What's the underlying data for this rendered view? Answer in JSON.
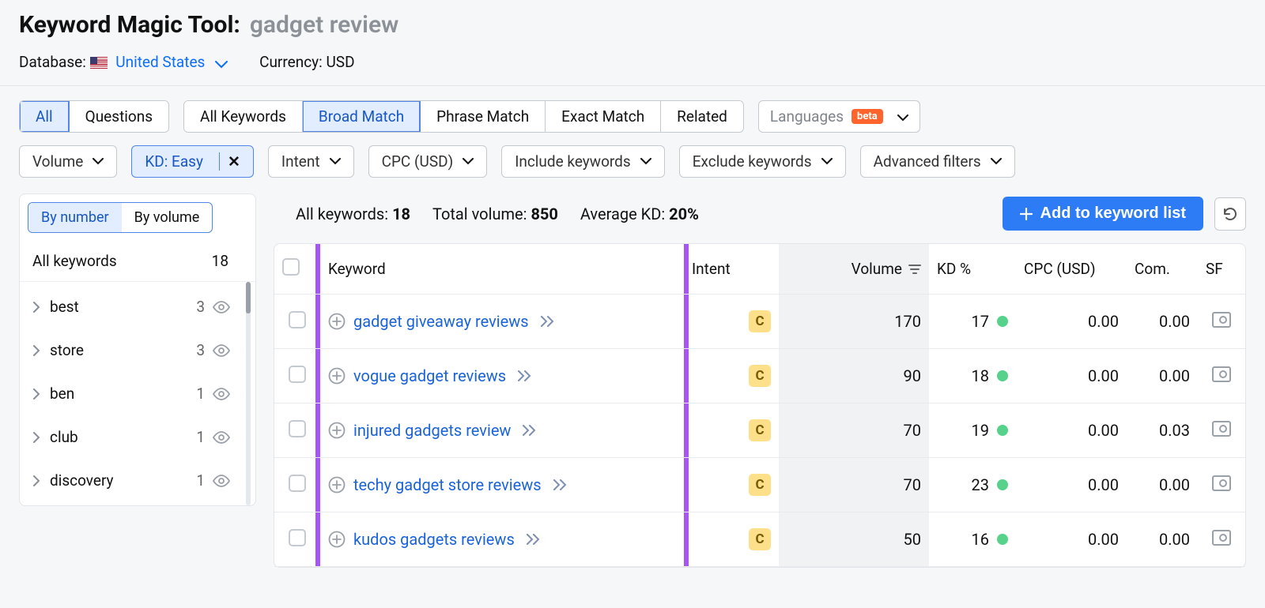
{
  "header": {
    "tool_name": "Keyword Magic Tool:",
    "query": "gadget review",
    "database_label": "Database:",
    "database_value": "United States",
    "currency_label": "Currency:",
    "currency_value": "USD"
  },
  "match_tabs": {
    "mode_all": "All",
    "mode_questions": "Questions",
    "all_keywords": "All Keywords",
    "broad": "Broad Match",
    "phrase": "Phrase Match",
    "exact": "Exact Match",
    "related": "Related",
    "languages": "Languages",
    "beta": "beta"
  },
  "filters": {
    "volume": "Volume",
    "kd": "KD: Easy",
    "intent": "Intent",
    "cpc": "CPC (USD)",
    "include": "Include keywords",
    "exclude": "Exclude keywords",
    "advanced": "Advanced filters"
  },
  "sidebar": {
    "tab_number": "By number",
    "tab_volume": "By volume",
    "all_label": "All keywords",
    "all_count": "18",
    "items": [
      {
        "label": "best",
        "count": "3"
      },
      {
        "label": "store",
        "count": "3"
      },
      {
        "label": "ben",
        "count": "1"
      },
      {
        "label": "club",
        "count": "1"
      },
      {
        "label": "discovery",
        "count": "1"
      }
    ]
  },
  "summary": {
    "all_kw_label": "All keywords:",
    "all_kw_value": "18",
    "total_vol_label": "Total volume:",
    "total_vol_value": "850",
    "avg_kd_label": "Average KD:",
    "avg_kd_value": "20%"
  },
  "actions": {
    "add": "Add to keyword list"
  },
  "columns": {
    "keyword": "Keyword",
    "intent": "Intent",
    "volume": "Volume",
    "kd": "KD %",
    "cpc": "CPC (USD)",
    "com": "Com.",
    "sf": "SF"
  },
  "rows": [
    {
      "keyword": "gadget giveaway reviews",
      "intent": "C",
      "volume": "170",
      "kd": "17",
      "cpc": "0.00",
      "com": "0.00"
    },
    {
      "keyword": "vogue gadget reviews",
      "intent": "C",
      "volume": "90",
      "kd": "18",
      "cpc": "0.00",
      "com": "0.00"
    },
    {
      "keyword": "injured gadgets review",
      "intent": "C",
      "volume": "70",
      "kd": "19",
      "cpc": "0.00",
      "com": "0.03"
    },
    {
      "keyword": "techy gadget store reviews",
      "intent": "C",
      "volume": "70",
      "kd": "23",
      "cpc": "0.00",
      "com": "0.00"
    },
    {
      "keyword": "kudos gadgets reviews",
      "intent": "C",
      "volume": "50",
      "kd": "16",
      "cpc": "0.00",
      "com": "0.00"
    }
  ]
}
